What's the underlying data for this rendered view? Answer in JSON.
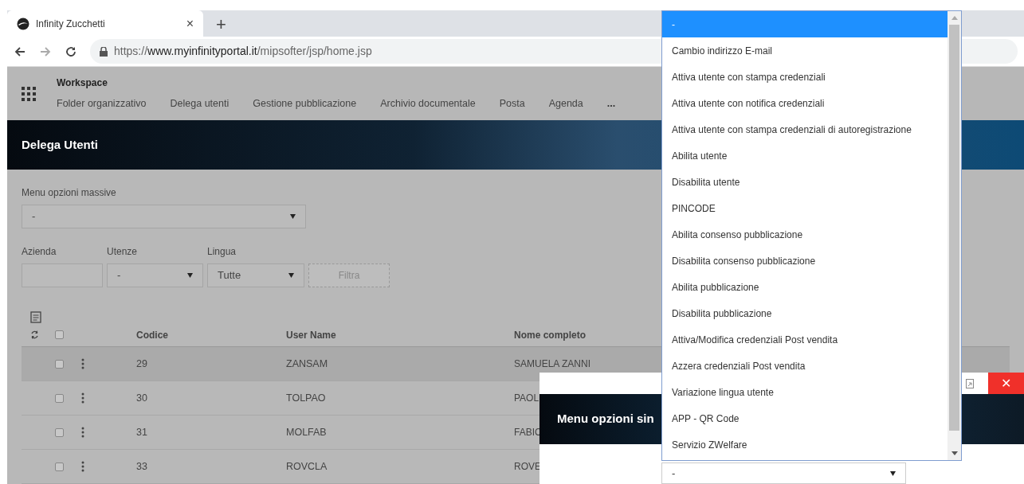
{
  "browser": {
    "tab": {
      "title": "Infinity Zucchetti",
      "close": "×"
    },
    "new_tab": "+",
    "url": {
      "scheme": "https://",
      "host": "www.myinfinityportal.it",
      "path": "/mipsofter/jsp/home.jsp"
    }
  },
  "app_header": {
    "title": "Workspace",
    "nav": [
      "Folder organizzativo",
      "Delega utenti",
      "Gestione pubblicazione",
      "Archivio documentale",
      "Posta",
      "Agenda"
    ],
    "more": "..."
  },
  "page_title": "Delega Utenti",
  "mass_menu": {
    "label": "Menu opzioni massive",
    "value": "-"
  },
  "filters": [
    {
      "kind": "text",
      "label": "Azienda"
    },
    {
      "kind": "select",
      "label": "Utenze",
      "value": "-"
    },
    {
      "kind": "select",
      "label": "Lingua",
      "value": "Tutte"
    }
  ],
  "filter_button": {
    "label": "Filtra",
    "disabled": true
  },
  "table": {
    "columns": [
      "Codice",
      "User Name",
      "Nome completo"
    ],
    "header_checked": false,
    "rows": [
      {
        "codice": "29",
        "user_name": "ZANSAM",
        "nome_completo": "SAMUELA ZANNI",
        "checked": false,
        "selected": true
      },
      {
        "codice": "30",
        "user_name": "TOLPAO",
        "nome_completo": "PAOL",
        "checked": false,
        "selected": false
      },
      {
        "codice": "31",
        "user_name": "MOLFAB",
        "nome_completo": "FABIC",
        "checked": false,
        "selected": false
      },
      {
        "codice": "33",
        "user_name": "ROVCLA",
        "nome_completo": "ROVE",
        "checked": false,
        "selected": false
      }
    ]
  },
  "modal": {
    "title": "Menu opzioni sin",
    "close": "✕",
    "select_value": "-"
  },
  "dropdown": {
    "options": [
      {
        "label": "-",
        "selected": true
      },
      {
        "label": "Cambio indirizzo E-mail",
        "selected": false
      },
      {
        "label": "Attiva utente con stampa credenziali",
        "selected": false
      },
      {
        "label": "Attiva utente con notifica credenziali",
        "selected": false
      },
      {
        "label": "Attiva utente con stampa credenziali di autoregistrazione",
        "selected": false
      },
      {
        "label": "Abilita utente",
        "selected": false
      },
      {
        "label": "Disabilita utente",
        "selected": false
      },
      {
        "label": "PINCODE",
        "selected": false
      },
      {
        "label": "Abilita consenso pubblicazione",
        "selected": false
      },
      {
        "label": "Disabilita consenso pubblicazione",
        "selected": false
      },
      {
        "label": "Abilita pubblicazione",
        "selected": false
      },
      {
        "label": "Disabilita pubblicazione",
        "selected": false
      },
      {
        "label": "Attiva/Modifica credenziali Post vendita",
        "selected": false
      },
      {
        "label": "Azzera credenziali Post vendita",
        "selected": false
      },
      {
        "label": "Variazione lingua utente",
        "selected": false
      },
      {
        "label": "APP - QR Code",
        "selected": false
      },
      {
        "label": "Servizio ZWelfare",
        "selected": false
      }
    ]
  }
}
